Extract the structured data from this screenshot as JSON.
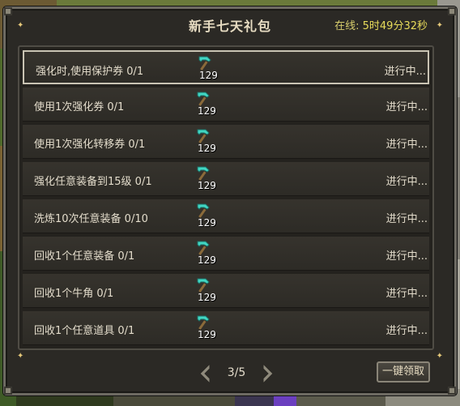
{
  "window": {
    "title": "新手七天礼包",
    "online_label": "在线:",
    "online_time": "5时49分32秒"
  },
  "tasks": [
    {
      "name": "强化时,使用保护券 0/1",
      "reward_qty": "129",
      "status": "进行中..."
    },
    {
      "name": "使用1次强化券 0/1",
      "reward_qty": "129",
      "status": "进行中..."
    },
    {
      "name": "使用1次强化转移券 0/1",
      "reward_qty": "129",
      "status": "进行中..."
    },
    {
      "name": "强化任意装备到15级 0/1",
      "reward_qty": "129",
      "status": "进行中..."
    },
    {
      "name": "洗炼10次任意装备 0/10",
      "reward_qty": "129",
      "status": "进行中..."
    },
    {
      "name": "回收1个任意装备 0/1",
      "reward_qty": "129",
      "status": "进行中..."
    },
    {
      "name": "回收1个牛角 0/1",
      "reward_qty": "129",
      "status": "进行中..."
    },
    {
      "name": "回收1个任意道具 0/1",
      "reward_qty": "129",
      "status": "进行中..."
    }
  ],
  "reward_icon": "diamond-pickaxe-icon",
  "pager": {
    "page": "3/5"
  },
  "claim_all_label": "一键领取",
  "colors": {
    "accent_text": "#e8dc5a",
    "reward_item": "#41d6c3"
  }
}
